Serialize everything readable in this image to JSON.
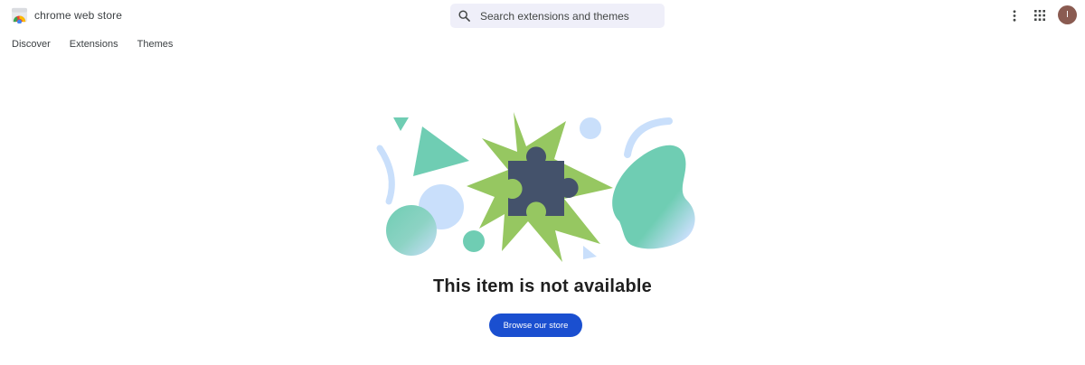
{
  "header": {
    "app_title": "chrome web store",
    "search": {
      "placeholder": "Search extensions and themes",
      "value": ""
    },
    "more_icon": "more-vert-icon",
    "apps_icon": "apps-grid-icon",
    "avatar_initial": "I"
  },
  "nav": {
    "items": [
      {
        "label": "Discover"
      },
      {
        "label": "Extensions"
      },
      {
        "label": "Themes"
      }
    ]
  },
  "main": {
    "message": "This item is not available",
    "cta_label": "Browse our store",
    "illustration_icon": "puzzle-piece-icon"
  },
  "colors": {
    "accent": "#1a4fd0",
    "search_bg": "#efeff9",
    "avatar_bg": "#8a5b51",
    "teal": "#6fcdb3",
    "green": "#96c761",
    "light_blue": "#c9dffb",
    "puzzle": "#44526b"
  }
}
